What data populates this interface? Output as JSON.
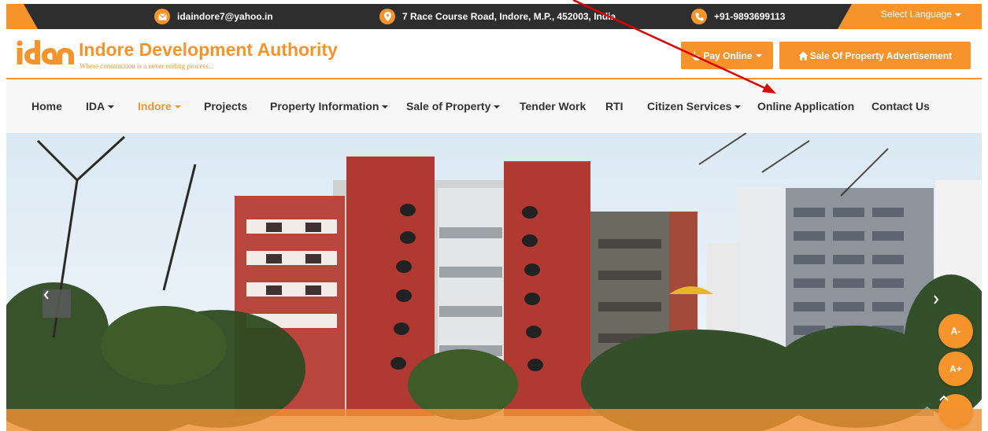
{
  "topbar": {
    "email": "idaindore7@yahoo.in",
    "address": "7 Race Course Road, Indore, M.P., 452003, India",
    "phone": "+91-9893699113",
    "language_label": "Select Language"
  },
  "header": {
    "logo_text": "ida",
    "title": "Indore Development Authority",
    "tagline": "Where construction is a never ending process...",
    "pay_online_label": "Pay Online",
    "sale_property_label": "Sale Of Property Advertisement"
  },
  "nav": {
    "items": [
      {
        "label": "Home",
        "dropdown": false
      },
      {
        "label": "IDA",
        "dropdown": true
      },
      {
        "label": "Indore",
        "dropdown": true,
        "active": true
      },
      {
        "label": "Projects",
        "dropdown": false
      },
      {
        "label": "Property Information",
        "dropdown": true
      },
      {
        "label": "Sale of Property",
        "dropdown": true
      },
      {
        "label": "Tender Work",
        "dropdown": false
      },
      {
        "label": "RTI",
        "dropdown": false
      },
      {
        "label": "Citizen Services",
        "dropdown": true
      },
      {
        "label": "Online Application",
        "dropdown": false
      },
      {
        "label": "Contact Us",
        "dropdown": false
      }
    ]
  },
  "hero": {
    "font_decrease_label": "A-",
    "font_increase_label": "A+"
  },
  "icons": {
    "email": "envelope-icon",
    "address": "map-pin-icon",
    "phone": "phone-icon",
    "pay": "hand-pointer-icon",
    "sale": "home-icon",
    "prev": "chevron-left-icon",
    "next": "chevron-right-icon",
    "top": "chevron-up-icon"
  },
  "colors": {
    "accent": "#f6932b",
    "topbar_dark": "#2e2e2e",
    "nav_text": "#333333",
    "annotation_arrow": "#e00000"
  }
}
